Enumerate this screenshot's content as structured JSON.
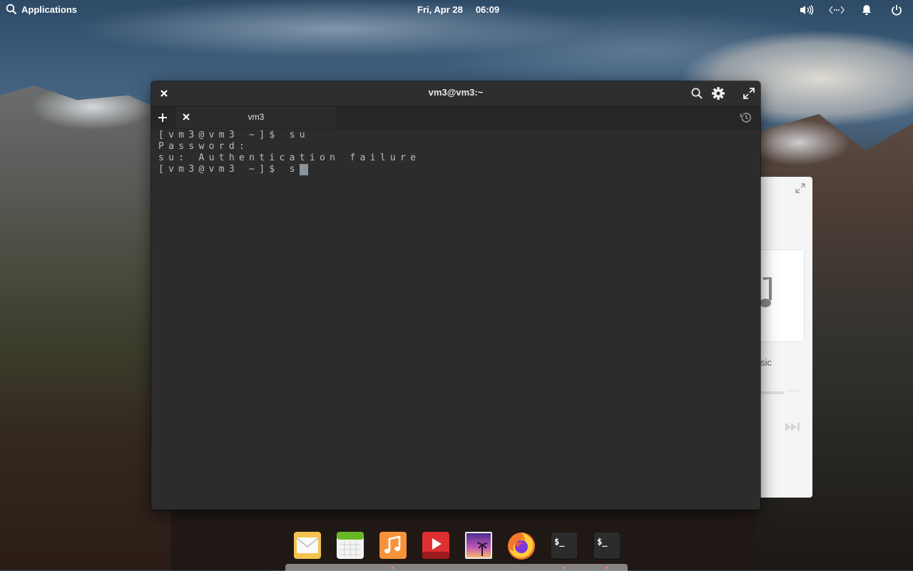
{
  "panel": {
    "applications_label": "Applications",
    "date": "Fri, Apr 28",
    "time": "06:09",
    "indicators": [
      "volume-icon",
      "network-icon",
      "notifications-icon",
      "power-icon"
    ]
  },
  "terminal": {
    "window_title": "vm3@vm3:~",
    "tab_label": "vm3",
    "lines": [
      "[vm3@vm3 ~]$ su",
      "Password:",
      "su: Authentication failure",
      "[vm3@vm3 ~]$ s"
    ]
  },
  "music_window": {
    "title_fragment": "sic",
    "time": "--:--"
  },
  "dock": {
    "items": [
      "mail-icon",
      "calendar-icon",
      "music-icon",
      "videos-icon",
      "photos-icon",
      "firefox-icon",
      "terminal-icon",
      "terminal-icon"
    ],
    "terminal_glyph": "$_"
  }
}
